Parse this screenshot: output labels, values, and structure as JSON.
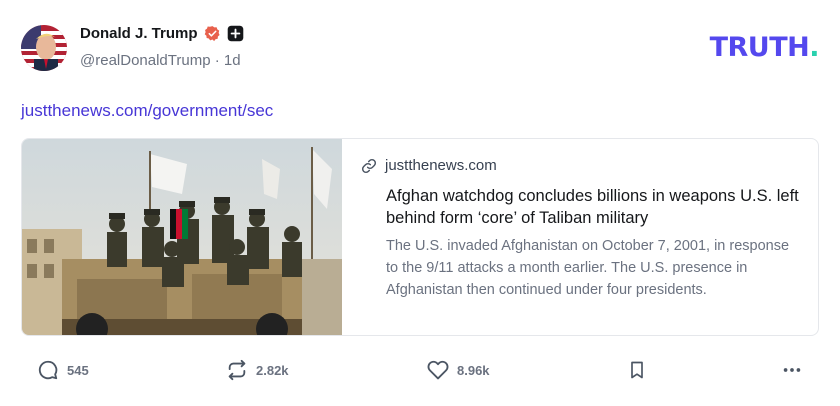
{
  "author": {
    "name": "Donald J. Trump",
    "handle": "@realDonaldTrump",
    "separator": "·",
    "time": "1d"
  },
  "brand": {
    "logo_text": "TRUTH",
    "logo_dot": ".",
    "primary_color": "#5448ee",
    "dot_color": "#2ad1ae"
  },
  "post": {
    "link_text": "justthenews.com/government/sec"
  },
  "card": {
    "domain": "justthenews.com",
    "title": "Afghan watchdog concludes billions in weapons U.S. left behind form ‘core’ of Taliban military",
    "description": "The U.S. invaded Afghanistan on October 7, 2001, in response to the 9/11 attacks a month earlier. The U.S. presence in Afghanistan then continued under four presidents."
  },
  "actions": {
    "replies": "545",
    "retruths": "2.82k",
    "likes": "8.96k"
  },
  "icons": [
    "verified-icon",
    "plus-icon",
    "link-icon",
    "reply-icon",
    "retruth-icon",
    "like-icon",
    "bookmark-icon",
    "more-icon"
  ]
}
